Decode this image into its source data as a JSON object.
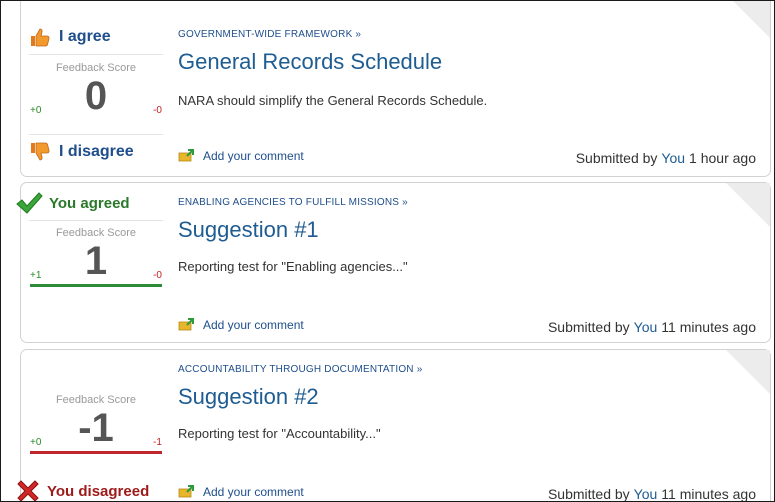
{
  "common": {
    "feedback_label": "Feedback Score",
    "add_comment": "Add your comment",
    "submitted_prefix": "Submitted by",
    "submitted_user": "You"
  },
  "suggestions": [
    {
      "category": "GOVERNMENT-WIDE FRAMEWORK »",
      "title": "General Records Schedule",
      "description": "NARA should simplify the General Records Schedule.",
      "agree_label": "I agree",
      "disagree_label": "I disagree",
      "score": "0",
      "up_votes": "+0",
      "down_votes": "-0",
      "time_ago": "1 hour ago"
    },
    {
      "category": "ENABLING AGENCIES TO FULFILL MISSIONS »",
      "title": "Suggestion #1",
      "description": "Reporting test for \"Enabling agencies...\"",
      "status": "You agreed",
      "score": "1",
      "up_votes": "+1",
      "down_votes": "-0",
      "time_ago": "11 minutes ago",
      "bar_color": "#2e8b3a"
    },
    {
      "category": "ACCOUNTABILITY THROUGH DOCUMENTATION »",
      "title": "Suggestion #2",
      "description": "Reporting test for \"Accountability...\"",
      "status": "You disagreed",
      "score": "-1",
      "up_votes": "+0",
      "down_votes": "-1",
      "time_ago": "11 minutes ago",
      "bar_color": "#c0262e"
    }
  ],
  "icons": {
    "agree": "thumbs-up-icon",
    "disagree": "thumbs-down-icon",
    "agreed": "check-mark-icon",
    "disagreed": "x-mark-icon",
    "comment": "comment-icon"
  }
}
